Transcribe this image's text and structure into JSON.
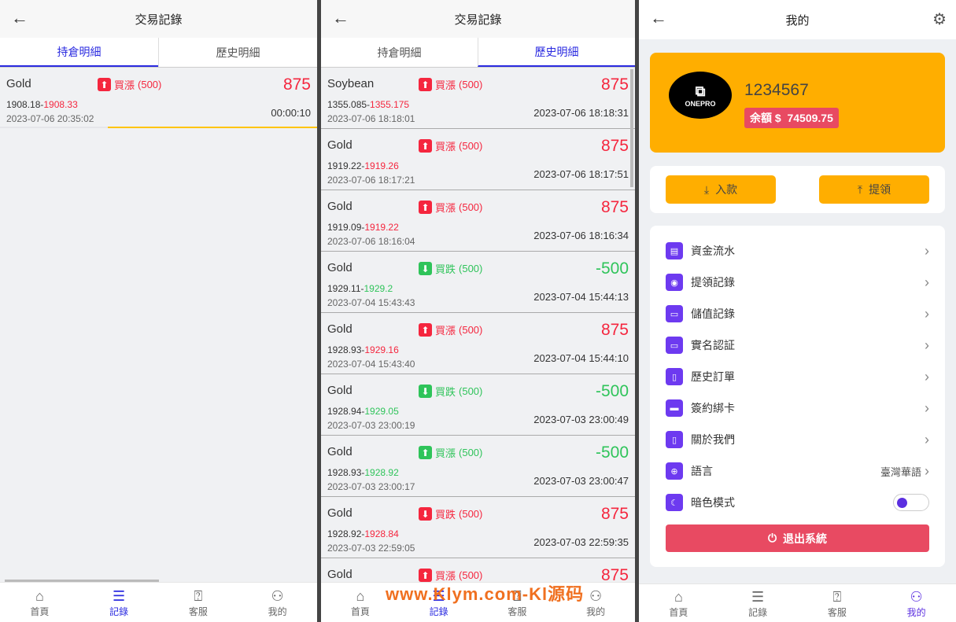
{
  "panel1": {
    "title": "交易記錄",
    "tabs": [
      "持倉明細",
      "歷史明細"
    ],
    "item": {
      "symbol": "Gold",
      "direction": "買漲",
      "qty": "(500)",
      "amount": "875",
      "open_price": "1908.18-",
      "close_price": "1908.33",
      "open_time": "2023-07-06 20:35:02",
      "countdown": "00:00:10",
      "progress": 0.34
    }
  },
  "panel2": {
    "title": "交易記錄",
    "tabs": [
      "持倉明細",
      "歷史明細"
    ],
    "items": [
      {
        "symbol": "Soybean",
        "direction": "買漲",
        "qty": "(500)",
        "amount": "875",
        "open_price": "1355.085-",
        "close_price": "1355.175",
        "open_time": "2023-07-06 18:18:01",
        "close_time": "2023-07-06 18:18:31",
        "color": "red",
        "arrow": "up"
      },
      {
        "symbol": "Gold",
        "direction": "買漲",
        "qty": "(500)",
        "amount": "875",
        "open_price": "1919.22-",
        "close_price": "1919.26",
        "open_time": "2023-07-06 18:17:21",
        "close_time": "2023-07-06 18:17:51",
        "color": "red",
        "arrow": "up"
      },
      {
        "symbol": "Gold",
        "direction": "買漲",
        "qty": "(500)",
        "amount": "875",
        "open_price": "1919.09-",
        "close_price": "1919.22",
        "open_time": "2023-07-06 18:16:04",
        "close_time": "2023-07-06 18:16:34",
        "color": "red",
        "arrow": "up"
      },
      {
        "symbol": "Gold",
        "direction": "買跌",
        "qty": "(500)",
        "amount": "-500",
        "open_price": "1929.11-",
        "close_price": "1929.2",
        "open_time": "2023-07-04 15:43:43",
        "close_time": "2023-07-04 15:44:13",
        "color": "green",
        "arrow": "down"
      },
      {
        "symbol": "Gold",
        "direction": "買漲",
        "qty": "(500)",
        "amount": "875",
        "open_price": "1928.93-",
        "close_price": "1929.16",
        "open_time": "2023-07-04 15:43:40",
        "close_time": "2023-07-04 15:44:10",
        "color": "red",
        "arrow": "up"
      },
      {
        "symbol": "Gold",
        "direction": "買跌",
        "qty": "(500)",
        "amount": "-500",
        "open_price": "1928.94-",
        "close_price": "1929.05",
        "open_time": "2023-07-03 23:00:19",
        "close_time": "2023-07-03 23:00:49",
        "color": "green",
        "arrow": "down"
      },
      {
        "symbol": "Gold",
        "direction": "買漲",
        "qty": "(500)",
        "amount": "-500",
        "open_price": "1928.93-",
        "close_price": "1928.92",
        "open_time": "2023-07-03 23:00:17",
        "close_time": "2023-07-03 23:00:47",
        "color": "green",
        "arrow": "up"
      },
      {
        "symbol": "Gold",
        "direction": "買跌",
        "qty": "(500)",
        "amount": "875",
        "open_price": "1928.92-",
        "close_price": "1928.84",
        "open_time": "2023-07-03 22:59:05",
        "close_time": "2023-07-03 22:59:35",
        "color": "red",
        "arrow": "down"
      },
      {
        "symbol": "Gold",
        "direction": "買漲",
        "qty": "(500)",
        "amount": "875",
        "open_price": "",
        "close_price": "",
        "open_time": "",
        "close_time": "",
        "color": "red",
        "arrow": "up"
      }
    ]
  },
  "nav": [
    "首頁",
    "記錄",
    "客服",
    "我的"
  ],
  "watermark": "www.Klym.com-Kl源码",
  "panel3": {
    "title": "我的",
    "logo_text": "ONEPRO",
    "user_id": "1234567",
    "balance_label": "余額 $",
    "balance": "74509.75",
    "deposit": "入款",
    "withdraw": "提領",
    "menu": [
      {
        "label": "資金流水",
        "icon": "list-icon"
      },
      {
        "label": "提領記錄",
        "icon": "location-icon"
      },
      {
        "label": "儲值記錄",
        "icon": "wallet-icon"
      },
      {
        "label": "實名認証",
        "icon": "id-card-icon"
      },
      {
        "label": "歷史訂單",
        "icon": "phone-icon"
      },
      {
        "label": "簽約綁卡",
        "icon": "card-icon"
      },
      {
        "label": "關於我們",
        "icon": "clipboard-icon"
      },
      {
        "label": "語言",
        "icon": "globe-icon",
        "value": "臺灣華語"
      },
      {
        "label": "暗色模式",
        "icon": "moon-icon"
      }
    ],
    "logout": "退出系統"
  },
  "colors": {
    "accent": "#ffae00",
    "up": "#f5263e",
    "down": "#2fc45a",
    "purple": "#6d3af0",
    "tab_active": "#2a2ae0"
  }
}
